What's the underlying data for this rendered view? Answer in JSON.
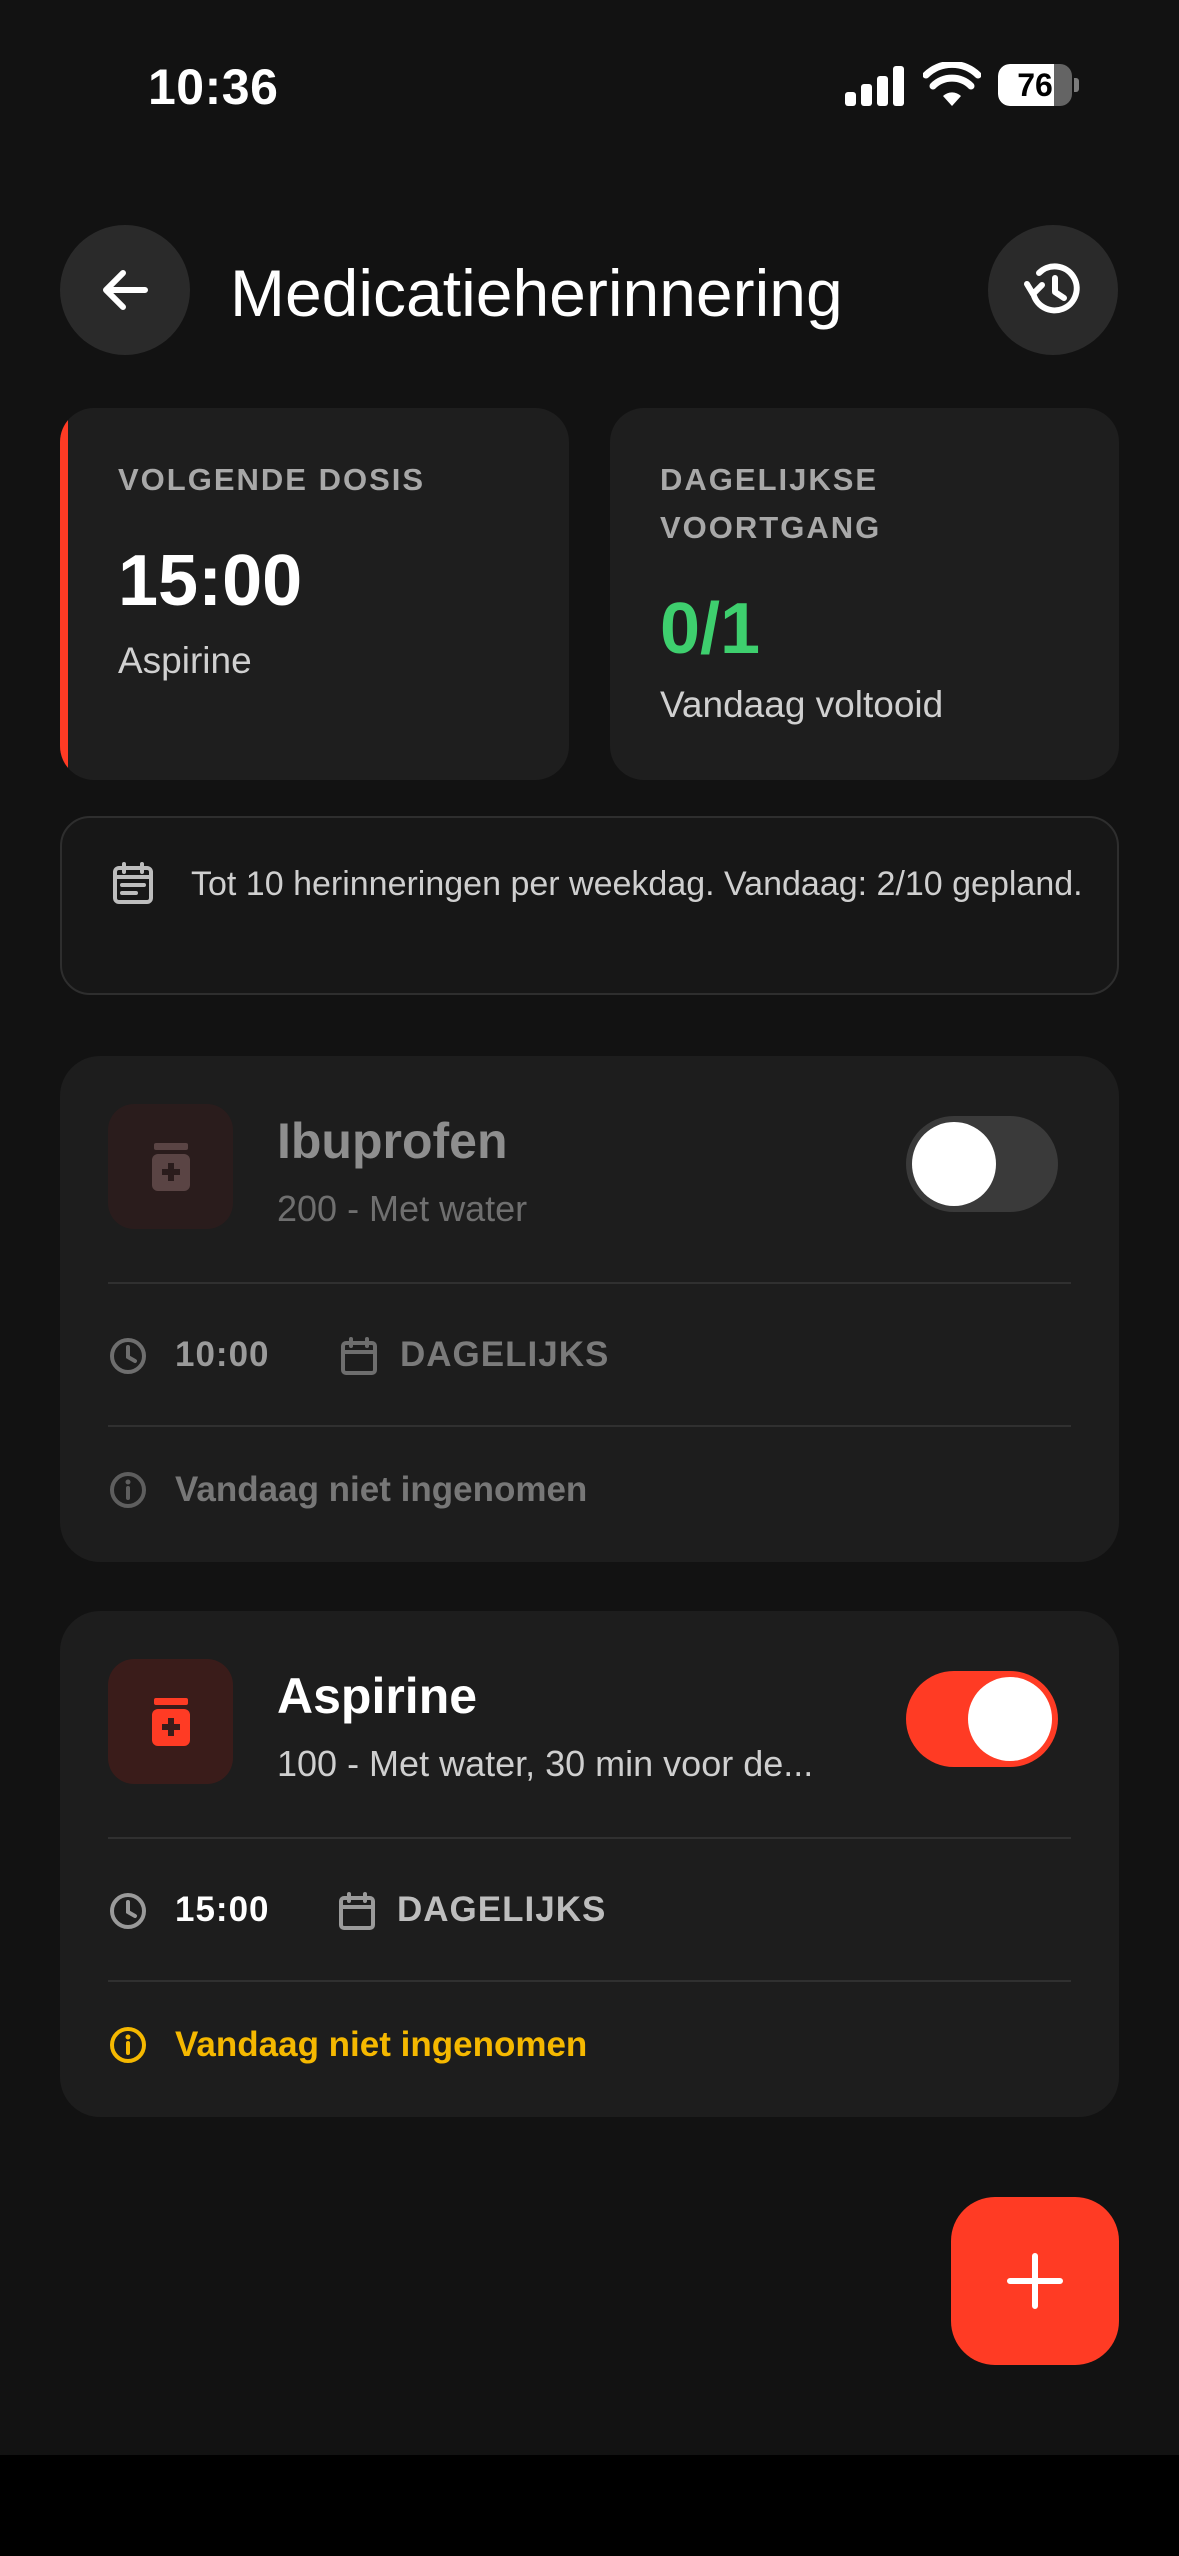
{
  "status_bar": {
    "time": "10:36",
    "battery": "76",
    "battery_level": 0.76
  },
  "header": {
    "title": "Medicatieherinnering",
    "back_icon": "arrow-left-icon",
    "history_icon": "history-icon"
  },
  "next_dose": {
    "label": "VOLGENDE DOSIS",
    "time": "15:00",
    "medication": "Aspirine",
    "accent_color": "#ff3b24"
  },
  "daily_progress": {
    "label_line1": "DAGELIJKSE",
    "label_line2": "VOORTGANG",
    "value": "0/1",
    "subtitle": "Vandaag voltooid",
    "value_color": "#3ecf6e"
  },
  "info": {
    "icon": "calendar-note-icon",
    "text": "Tot 10 herinneringen per weekdag. Vandaag: 2/10 gepland."
  },
  "medications": [
    {
      "name": "Ibuprofen",
      "detail": "200 - Met water",
      "enabled": false,
      "time": "10:00",
      "frequency": "DAGELIJKS",
      "status": "Vandaag niet ingenomen",
      "status_color": "#777777"
    },
    {
      "name": "Aspirine",
      "detail": "100 - Met water, 30 min voor de...",
      "enabled": true,
      "time": "15:00",
      "frequency": "DAGELIJKS",
      "status": "Vandaag niet ingenomen",
      "status_color": "#f5b800"
    }
  ],
  "fab": {
    "icon": "plus-icon"
  },
  "colors": {
    "accent": "#ff3b24",
    "success": "#3ecf6e",
    "warning": "#f5b800",
    "background": "#121212",
    "card": "#1d1d1d"
  }
}
